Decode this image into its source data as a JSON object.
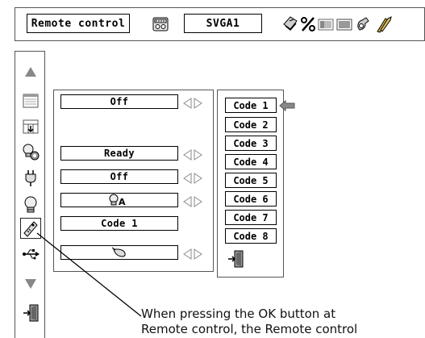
{
  "topbar": {
    "menu_label": "Remote control",
    "input_label": "SVGA1",
    "icons": [
      "remote-sensor-icon",
      "pc-adjust-icon",
      "percent-icon",
      "image-select-icon",
      "screen-icon",
      "lamp-icon",
      "tools-icon"
    ]
  },
  "sidebar": {
    "items": [
      "up-arrow-icon",
      "image-adjust-icon",
      "screen-icon",
      "lamp-settings-icon",
      "power-icon",
      "lamp-mode-icon",
      "remote-control-icon",
      "usb-icon",
      "down-arrow-icon",
      "exit-icon"
    ],
    "selected": "remote-control-icon"
  },
  "settings": {
    "rows": [
      {
        "value": "Off",
        "adjustable": true
      },
      {
        "value": "Ready",
        "adjustable": true
      },
      {
        "value": "Off",
        "adjustable": true
      },
      {
        "value": "",
        "icon": "lamp-auto-icon",
        "adjustable": true
      },
      {
        "value": "Code 1",
        "adjustable": false
      },
      {
        "value": "",
        "icon": "mouse-icon",
        "adjustable": true
      }
    ]
  },
  "codes": {
    "items": [
      "Code 1",
      "Code 2",
      "Code 3",
      "Code 4",
      "Code 5",
      "Code 6",
      "Code 7",
      "Code 8"
    ],
    "selected": "Code 1",
    "exit_icon": "exit-icon"
  },
  "caption": {
    "line1": "When pressing the OK button at",
    "line2": "Remote control, the Remote control"
  }
}
